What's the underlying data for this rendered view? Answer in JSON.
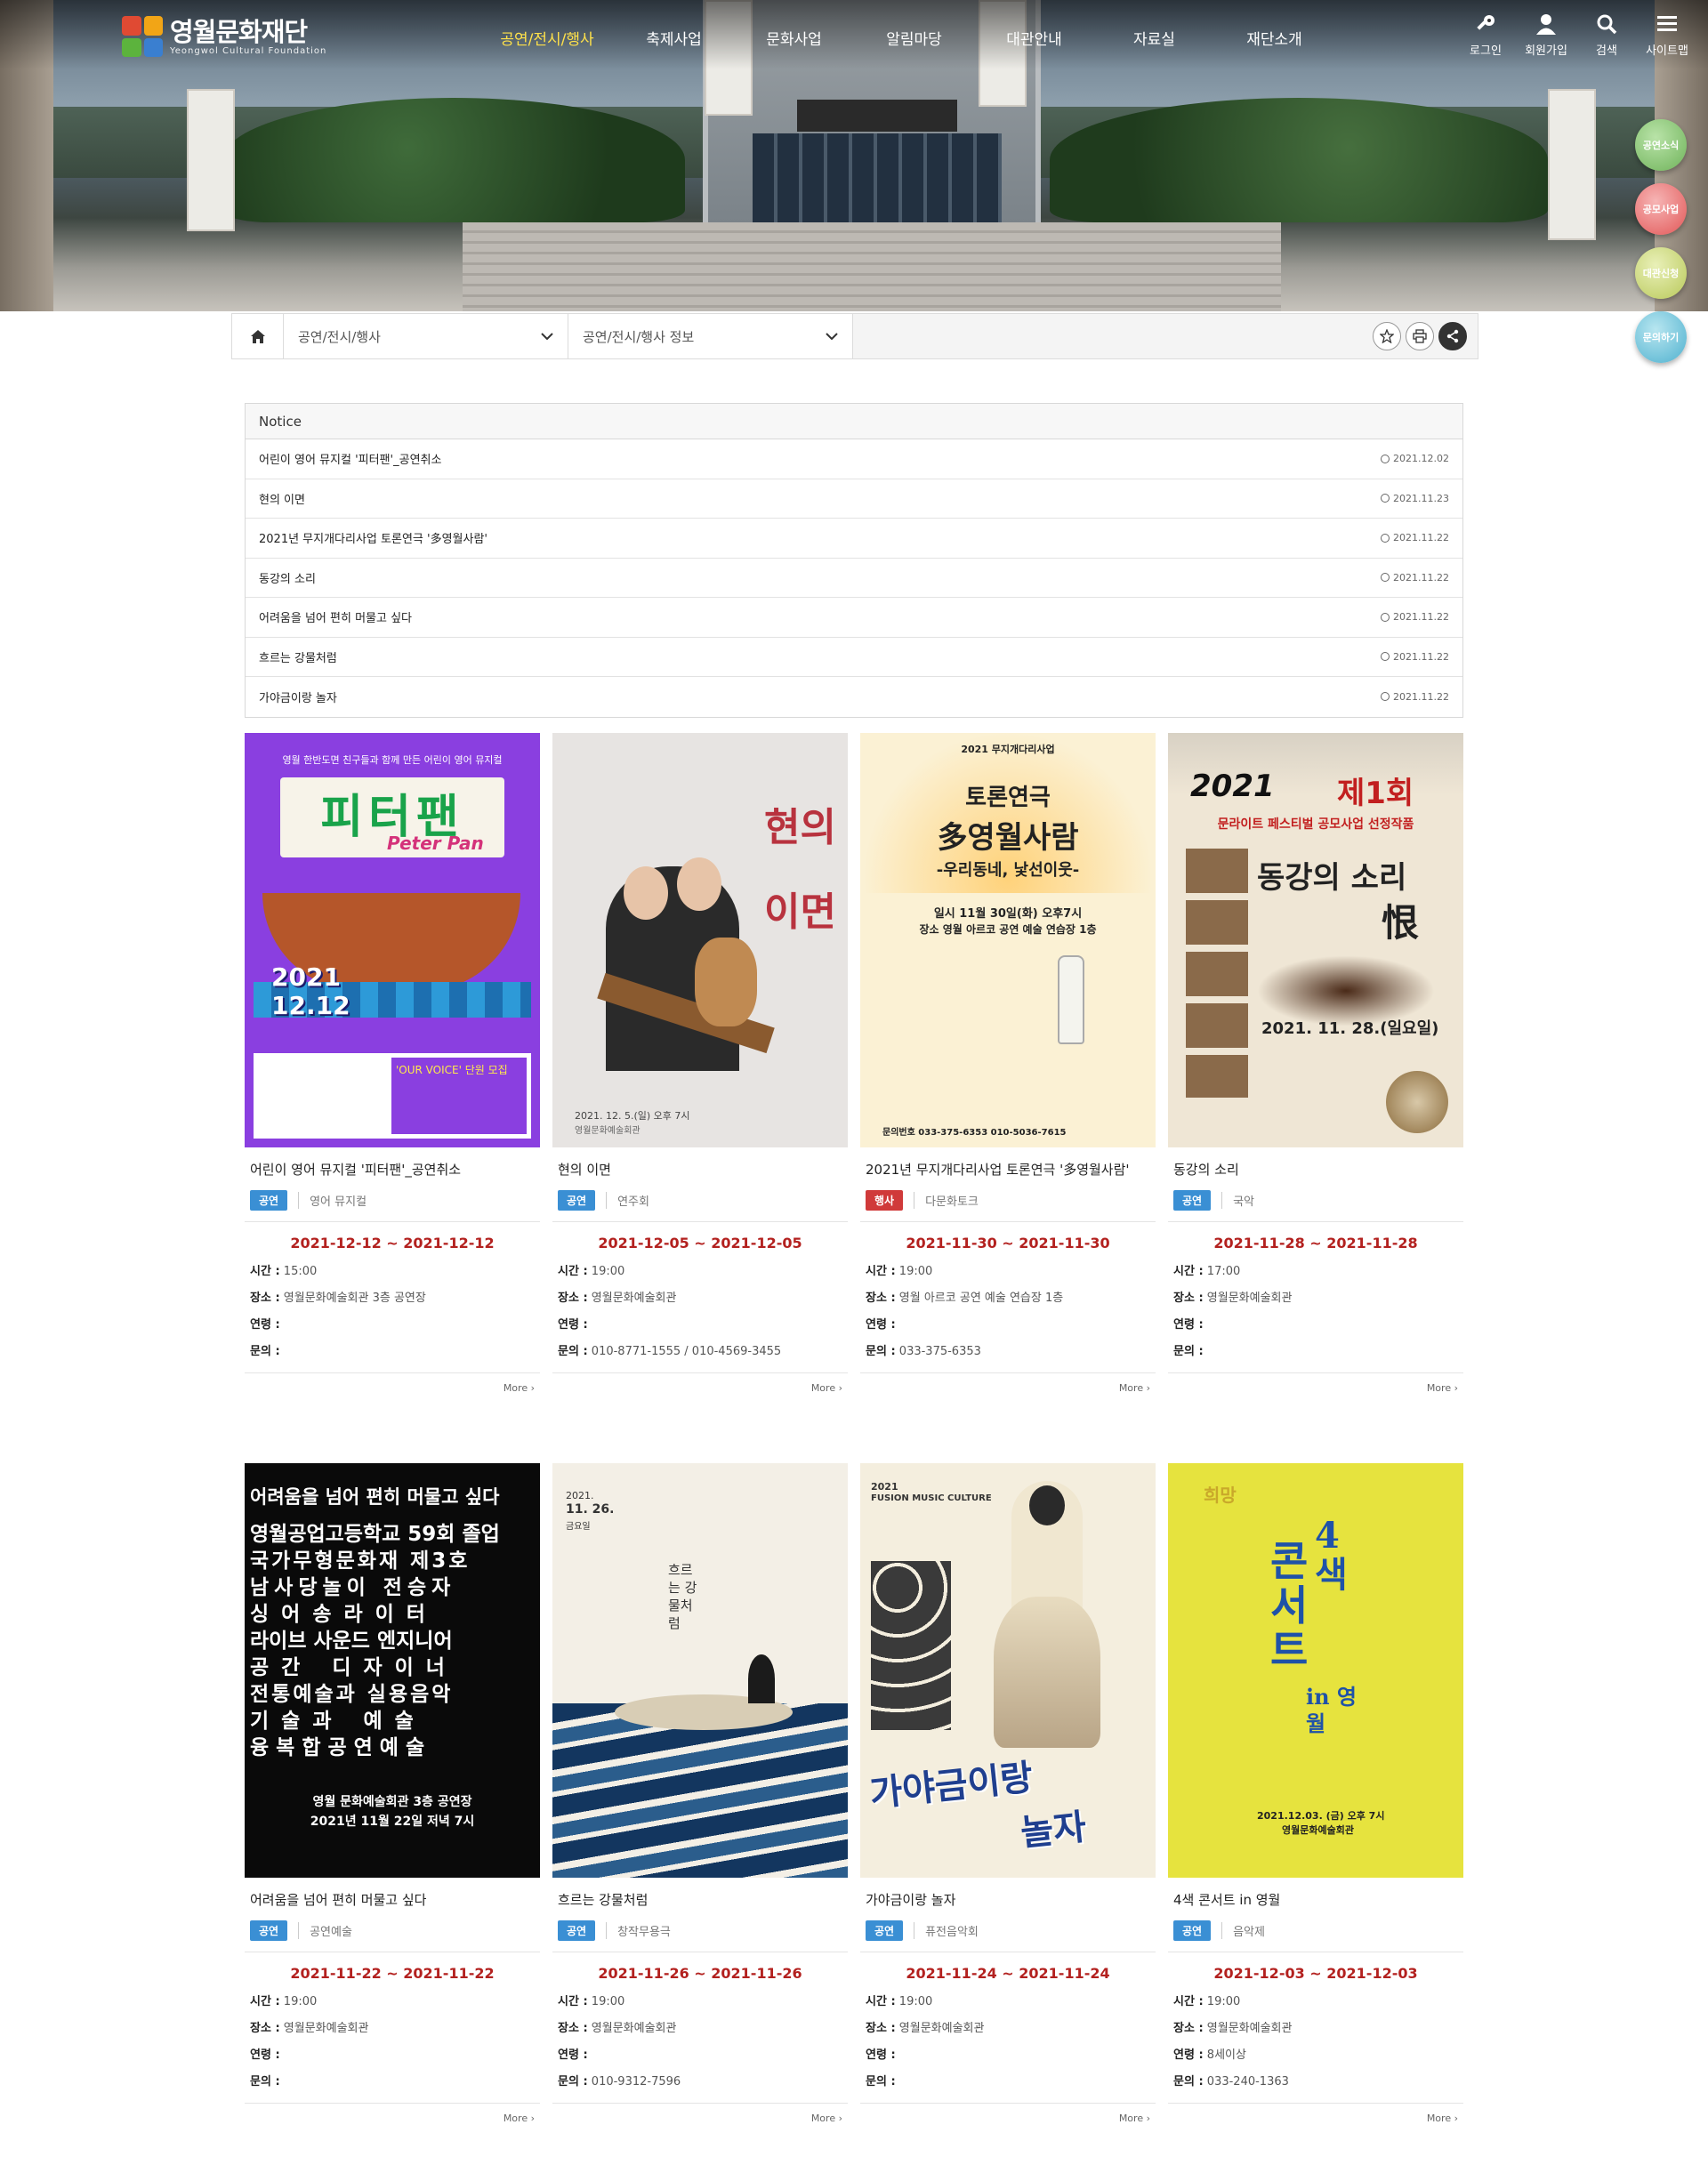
{
  "header": {
    "logo_kr": "영월문화재단",
    "logo_en": "Yeongwol Cultural Foundation",
    "nav": [
      "공연/전시/행사",
      "축제사업",
      "문화사업",
      "알림마당",
      "대관안내",
      "자료실",
      "재단소개"
    ],
    "util": [
      "로그인",
      "회원가입",
      "검색",
      "사이트맵"
    ]
  },
  "quick": [
    "공연소식",
    "공모사업",
    "대관신청",
    "문의하기"
  ],
  "location": {
    "depth1": "공연/전시/행사",
    "depth2": "공연/전시/행사 정보"
  },
  "notice": {
    "title": "Notice",
    "items": [
      {
        "title": "어린이 영어 뮤지컬 '피터팬'_공연취소",
        "date": "2021.12.02"
      },
      {
        "title": "현의 이면",
        "date": "2021.11.23"
      },
      {
        "title": "2021년 무지개다리사업 토론연극 '多영월사람'",
        "date": "2021.11.22"
      },
      {
        "title": "동강의 소리",
        "date": "2021.11.22"
      },
      {
        "title": "어려움을 넘어 편히 머물고 싶다",
        "date": "2021.11.22"
      },
      {
        "title": "흐르는 강물처럼",
        "date": "2021.11.22"
      },
      {
        "title": "가야금이랑 놀자",
        "date": "2021.11.22"
      }
    ]
  },
  "labels": {
    "time": "시간 :",
    "place": "장소 :",
    "age": "연령 :",
    "contact": "문의 :",
    "more": "More"
  },
  "cards": [
    {
      "title": "어린이 영어 뮤지컬 '피터팬'_공연취소",
      "badge": "공연",
      "badge_color": "#3a8fd4",
      "genre": "영어 뮤지컬",
      "period": "2021-12-12 ~ 2021-12-12",
      "time": "15:00",
      "place": "영월문화예술회관 3층 공연장",
      "age": "",
      "contact": "",
      "poster": {
        "l1": "피터팬",
        "l2": "Peter Pan",
        "l3": "2021",
        "l4": "12.12",
        "l5": "영월 한반도면 친구들과 함께 만든 어린이 영어 뮤지컬",
        "l6": "'OUR VOICE' 단원 모집"
      }
    },
    {
      "title": "현의 이면",
      "badge": "공연",
      "badge_color": "#3a8fd4",
      "genre": "연주회",
      "period": "2021-12-05 ~ 2021-12-05",
      "time": "19:00",
      "place": "영월문화예술회관",
      "age": "",
      "contact": "010-8771-1555 / 010-4569-3455",
      "poster": {
        "l1": "현의",
        "l2": "이면",
        "l3": "2021. 12. 5.(일) 오후 7시",
        "l4": "영월문화예술회관"
      }
    },
    {
      "title": "2021년 무지개다리사업 토론연극 '多영월사람'",
      "badge": "행사",
      "badge_color": "#d03a3a",
      "genre": "다문화토크",
      "period": "2021-11-30 ~ 2021-11-30",
      "time": "19:00",
      "place": "영월 아르코 공연 예술 연습장 1층",
      "age": "",
      "contact": "033-375-6353",
      "poster": {
        "l1": "2021 무지개다리사업",
        "l2": "토론연극",
        "l3": "多영월사람",
        "l4": "-우리동네, 낯선이웃-",
        "l5": "일시 11월 30일(화) 오후7시",
        "l6": "장소 영월 아르코 공연 예술 연습장 1층",
        "l7": "문의번호 033-375-6353  010-5036-7615"
      }
    },
    {
      "title": "동강의 소리",
      "badge": "공연",
      "badge_color": "#3a8fd4",
      "genre": "국악",
      "period": "2021-11-28 ~ 2021-11-28",
      "time": "17:00",
      "place": "영월문화예술회관",
      "age": "",
      "contact": "",
      "poster": {
        "l1": "2021",
        "l2": "제1회",
        "l3": "문라이트 페스티벌 공모사업 선정작품",
        "l4": "동강의 소리",
        "l5": "恨",
        "l6": "2021. 11. 28.(일요일)"
      }
    },
    {
      "title": "어려움을 넘어 편히 머물고 싶다",
      "badge": "공연",
      "badge_color": "#3a8fd4",
      "genre": "공연예술",
      "period": "2021-11-22 ~ 2021-11-22",
      "time": "19:00",
      "place": "영월문화예술회관",
      "age": "",
      "contact": "",
      "poster": {
        "l1": "어려움을 넘어 편히 머물고 싶다",
        "l2": "영월공업고등학교 59회 졸업",
        "l3": "국가무형문화재 제3호",
        "l4": "남사당놀이 전승자",
        "l5": "싱어송라이터",
        "l6": "라이브 사운드 엔지니어",
        "l7": "공간 디자이너",
        "l8": "전통예술과 실용음악",
        "l9": "기술과 예술",
        "l10": "융복합공연예술",
        "l11": "영월 문화예술회관 3층 공연장",
        "l12": "2021년 11월 22일 저녁 7시"
      }
    },
    {
      "title": "흐르는 강물처럼",
      "badge": "공연",
      "badge_color": "#3a8fd4",
      "genre": "창작무용극",
      "period": "2021-11-26 ~ 2021-11-26",
      "time": "19:00",
      "place": "영월문화예술회관",
      "age": "",
      "contact": "010-9312-7596",
      "poster": {
        "l1": "2021.",
        "l2": "11. 26.",
        "l3": "금요일",
        "l4": "흐르는 강물처럼"
      }
    },
    {
      "title": "가야금이랑 놀자",
      "badge": "공연",
      "badge_color": "#3a8fd4",
      "genre": "퓨전음악회",
      "period": "2021-11-24 ~ 2021-11-24",
      "time": "19:00",
      "place": "영월문화예술회관",
      "age": "",
      "contact": "",
      "poster": {
        "l1": "2021",
        "l2": "FUSION MUSIC CULTURE",
        "l3": "가야금이랑",
        "l4": "놀자"
      }
    },
    {
      "title": "4색 콘서트 in 영월",
      "badge": "공연",
      "badge_color": "#3a8fd4",
      "genre": "음악제",
      "period": "2021-12-03 ~ 2021-12-03",
      "time": "19:00",
      "place": "영월문화예술회관",
      "age": "8세이상",
      "contact": "033-240-1363",
      "poster": {
        "l1": "희망",
        "l2": "4색",
        "l3": "콘서트",
        "l4": "in 영월",
        "l5": "2021.12.03. (금) 오후 7시",
        "l6": "영월문화예술회관"
      }
    }
  ]
}
